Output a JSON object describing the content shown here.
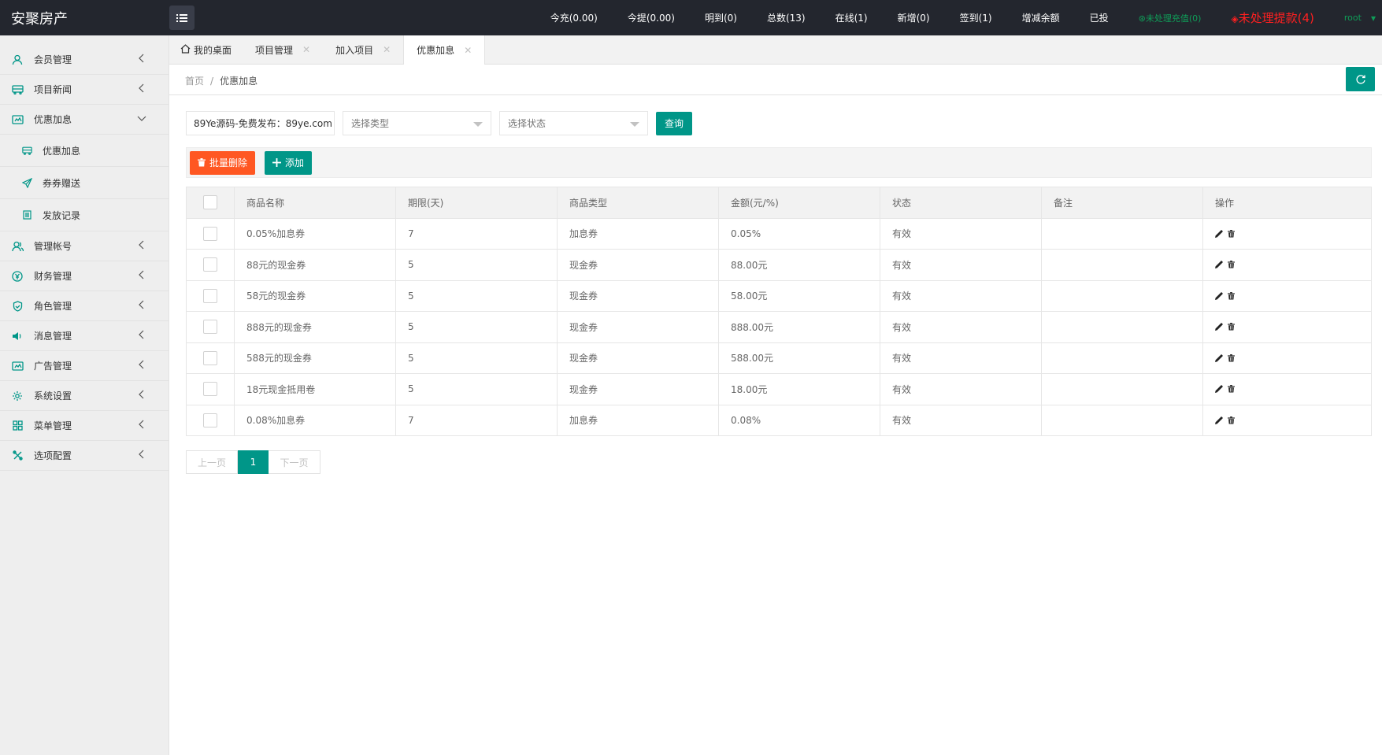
{
  "app": {
    "title": "安聚房产"
  },
  "topnav": {
    "items": [
      "今充(0.00)",
      "今提(0.00)",
      "明到(0)",
      "总数(13)",
      "在线(1)",
      "新增(0)",
      "签到(1)",
      "增减余额",
      "已投"
    ],
    "pending_recharge": "未处理充值(0)",
    "pending_withdraw": "未处理提款(4)",
    "user": "root"
  },
  "sidebar": {
    "items": [
      {
        "label": "会员管理",
        "icon": "user-icon"
      },
      {
        "label": "项目新闻",
        "icon": "bus-icon"
      },
      {
        "label": "优惠加息",
        "icon": "card-icon",
        "expanded": true
      },
      {
        "label": "管理帐号",
        "icon": "users-icon"
      },
      {
        "label": "财务管理",
        "icon": "finance-icon"
      },
      {
        "label": "角色管理",
        "icon": "shield-icon"
      },
      {
        "label": "消息管理",
        "icon": "speaker-icon"
      },
      {
        "label": "广告管理",
        "icon": "card-icon"
      },
      {
        "label": "系统设置",
        "icon": "gear-icon"
      },
      {
        "label": "菜单管理",
        "icon": "grid-icon"
      },
      {
        "label": "选项配置",
        "icon": "tools-icon"
      }
    ],
    "subitems": [
      {
        "label": "优惠加息",
        "icon": "bus-icon"
      },
      {
        "label": "券券赠送",
        "icon": "send-icon"
      },
      {
        "label": "发放记录",
        "icon": "list-icon"
      }
    ]
  },
  "tabs": [
    {
      "label": "我的桌面"
    },
    {
      "label": "项目管理"
    },
    {
      "label": "加入项目"
    },
    {
      "label": "优惠加息"
    }
  ],
  "breadcrumb": {
    "home": "首页",
    "sep": "/",
    "current": "优惠加息"
  },
  "search": {
    "keyword_value": "89Ye源码-免费发布：89ye.com",
    "type_placeholder": "选择类型",
    "status_placeholder": "选择状态",
    "query_label": "查询"
  },
  "toolbar": {
    "batch_delete_label": "批量删除",
    "add_label": "添加"
  },
  "table": {
    "headers": [
      "商品名称",
      "期限(天)",
      "商品类型",
      "金额(元/%)",
      "状态",
      "备注",
      "操作"
    ],
    "rows": [
      [
        "0.05%加息券",
        "7",
        "加息券",
        "0.05%",
        "有效",
        ""
      ],
      [
        "88元的现金券",
        "5",
        "现金券",
        "88.00元",
        "有效",
        ""
      ],
      [
        "58元的现金券",
        "5",
        "现金券",
        "58.00元",
        "有效",
        ""
      ],
      [
        "888元的现金券",
        "5",
        "现金券",
        "888.00元",
        "有效",
        ""
      ],
      [
        "588元的现金券",
        "5",
        "现金券",
        "588.00元",
        "有效",
        ""
      ],
      [
        "18元现金抵用卷",
        "5",
        "现金券",
        "18.00元",
        "有效",
        ""
      ],
      [
        "0.08%加息券",
        "7",
        "加息券",
        "0.08%",
        "有效",
        ""
      ]
    ]
  },
  "pager": {
    "prev": "上一页",
    "current": "1",
    "next": "下一页"
  },
  "colors": {
    "primary": "#009688",
    "danger": "#ff5722",
    "topbar": "#23262e",
    "alert_red": "#ff2020",
    "ok_green": "#0f9d58"
  }
}
